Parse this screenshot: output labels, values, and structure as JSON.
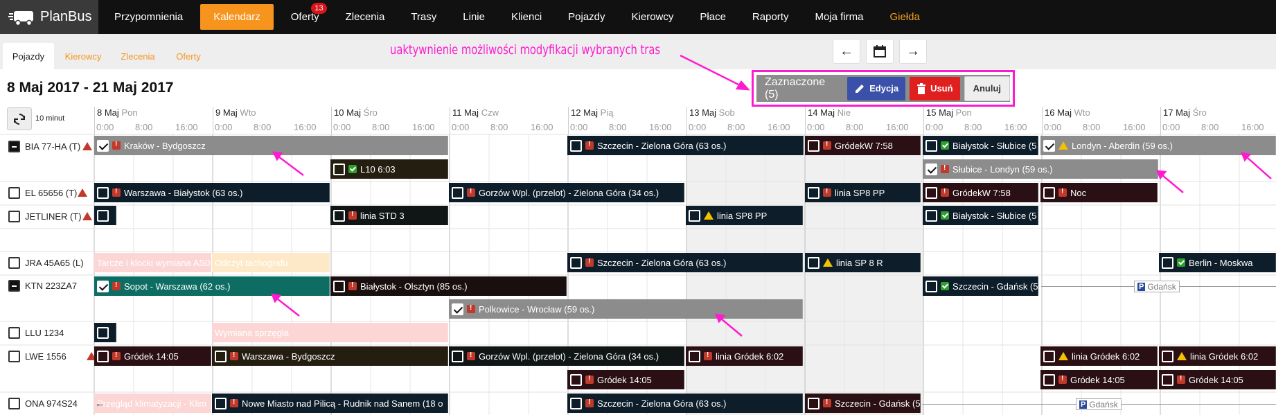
{
  "app": {
    "logo_text": "PlanBus"
  },
  "nav": [
    {
      "label": "Przypomnienia"
    },
    {
      "label": "Kalendarz"
    },
    {
      "label": "Oferty",
      "badge": "13"
    },
    {
      "label": "Zlecenia"
    },
    {
      "label": "Trasy"
    },
    {
      "label": "Linie"
    },
    {
      "label": "Klienci"
    },
    {
      "label": "Pojazdy"
    },
    {
      "label": "Kierowcy"
    },
    {
      "label": "Płace"
    },
    {
      "label": "Raporty"
    },
    {
      "label": "Moja firma"
    },
    {
      "label": "Giełda"
    }
  ],
  "subtabs": [
    {
      "label": "Pojazdy"
    },
    {
      "label": "Kierowcy"
    },
    {
      "label": "Zlecenia"
    },
    {
      "label": "Oferty"
    }
  ],
  "annotation": "uaktywnienie możliwości modyfikacji wybranych tras",
  "selection": {
    "count_label": "Zaznaczone (5)",
    "edit": "Edycja",
    "delete": "Usuń",
    "cancel": "Anuluj"
  },
  "date_range": "8 Maj 2017 - 21 Maj 2017",
  "interval": "10 minut",
  "days": [
    {
      "date": "8 Maj",
      "dow": "Pon"
    },
    {
      "date": "9 Maj",
      "dow": "Wto"
    },
    {
      "date": "10 Maj",
      "dow": "Śro"
    },
    {
      "date": "11 Maj",
      "dow": "Czw"
    },
    {
      "date": "12 Maj",
      "dow": "Pią"
    },
    {
      "date": "13 Maj",
      "dow": "Sob"
    },
    {
      "date": "14 Maj",
      "dow": "Nie"
    },
    {
      "date": "15 Maj",
      "dow": "Pon"
    },
    {
      "date": "16 Maj",
      "dow": "Wto"
    },
    {
      "date": "17 Maj",
      "dow": "Śro"
    }
  ],
  "hours": [
    "0:00",
    "8:00",
    "16:00"
  ],
  "vehicles": [
    {
      "name": "BIA 77-HA (T)"
    },
    {
      "name": "EL 65656 (T)"
    },
    {
      "name": "JETLINER (T)"
    },
    {
      "name": "JRA 45A65 (L)"
    },
    {
      "name": "KTN 223ZA7"
    },
    {
      "name": "LLU 1234"
    },
    {
      "name": "LWE 1556"
    },
    {
      "name": "ONA 974S24"
    }
  ],
  "events": {
    "e1": "Kraków - Bydgoszcz",
    "e2": "Szczecin - Zielona Góra (63 os.)",
    "e3": "GródekW 7:58",
    "e4": "Białystok - Słubice (5",
    "e5": "Londyn - Aberdin (59 os.)",
    "e6": "L10 6:03",
    "e7": "Słubice - Londyn (59 os.)",
    "e8": "Warszawa - Białystok (63 os.)",
    "e9": "Gorzów Wpl. (przelot) - Zielona Góra (34 os.)",
    "e10": "linia SP8 PP",
    "e11": "GródekW 7:58",
    "e12": "Noc",
    "e13": "linia STD 3",
    "e14": "linia SP8 PP",
    "e15": "Białystok - Słubice (5",
    "e16": "Tarcze i klocki wymiana AS0",
    "e17": "Odczyt tachografu",
    "e18": "Szczecin - Zielona Góra (63 os.)",
    "e19": "linia SP 8 R",
    "e20": "Berlin - Moskwa",
    "e21": "Sopot - Warszawa (62 os.)",
    "e22": "Białystok - Olsztyn (85 os.)",
    "e23": "Szczecin - Gdańsk (5",
    "e24": "Polkowice - Wrocław (59 os.)",
    "e25": "Wymiana sprzęgła",
    "e26": "Gródek 14:05",
    "e27": "Warszawa - Bydgoszcz",
    "e28": "Gorzów Wpl. (przelot) - Zielona Góra (34 os.)",
    "e29": "linia Gródek 6:02",
    "e30": "linia Gródek 6:02",
    "e31": "linia Gródek 6:02",
    "e32": "Gródek 14:05",
    "e33": "Gródek 14:05",
    "e34": "Gródek 14:05",
    "e35": "Przegląd klimatyzacji - Klim",
    "e36": "Nowe Miasto nad Pilicą - Rudnik nad Sanem (18 o",
    "e37": "Szczecin - Zielona Góra (63 os.)",
    "e38": "Szczecin - Gdańsk (5"
  },
  "parking": {
    "p1": "Gdańsk",
    "p2": "Gdańsk"
  }
}
